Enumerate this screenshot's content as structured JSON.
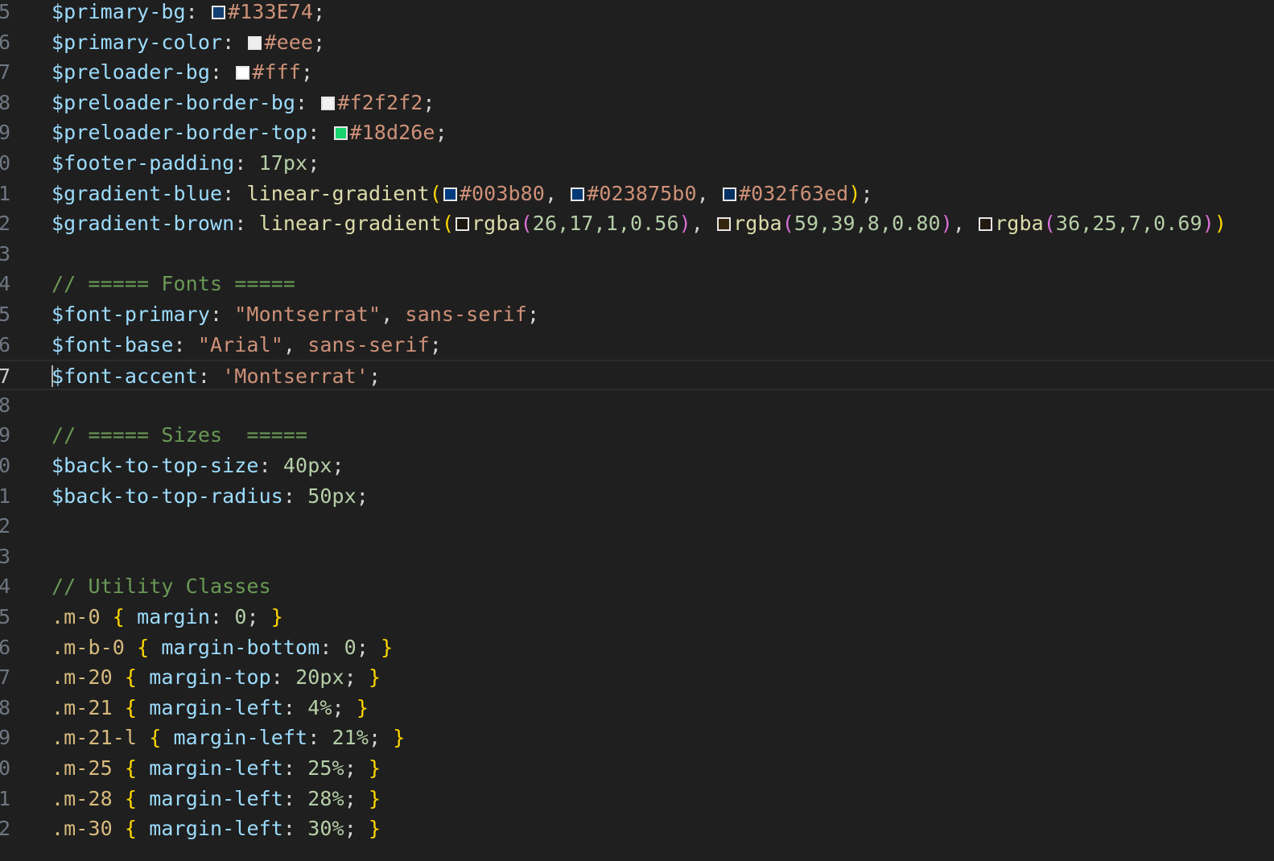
{
  "editor": {
    "active_line": 17,
    "lines": [
      {
        "no": "5",
        "tokens": [
          {
            "t": "$primary-bg",
            "c": "var"
          },
          {
            "t": ": ",
            "c": "txt"
          },
          {
            "swatch": "#133E74"
          },
          {
            "t": "#133E74",
            "c": "str"
          },
          {
            "t": ";",
            "c": "txt"
          }
        ]
      },
      {
        "no": "6",
        "tokens": [
          {
            "t": "$primary-color",
            "c": "var"
          },
          {
            "t": ": ",
            "c": "txt"
          },
          {
            "swatch": "#eeeeee"
          },
          {
            "t": "#eee",
            "c": "str"
          },
          {
            "t": ";",
            "c": "txt"
          }
        ]
      },
      {
        "no": "7",
        "tokens": [
          {
            "t": "$preloader-bg",
            "c": "var"
          },
          {
            "t": ": ",
            "c": "txt"
          },
          {
            "swatch": "#ffffff"
          },
          {
            "t": "#fff",
            "c": "str"
          },
          {
            "t": ";",
            "c": "txt"
          }
        ]
      },
      {
        "no": "8",
        "tokens": [
          {
            "t": "$preloader-border-bg",
            "c": "var"
          },
          {
            "t": ": ",
            "c": "txt"
          },
          {
            "swatch": "#f2f2f2"
          },
          {
            "t": "#f2f2f2",
            "c": "str"
          },
          {
            "t": ";",
            "c": "txt"
          }
        ]
      },
      {
        "no": "9",
        "tokens": [
          {
            "t": "$preloader-border-top",
            "c": "var"
          },
          {
            "t": ": ",
            "c": "txt"
          },
          {
            "swatch": "#18d26e"
          },
          {
            "t": "#18d26e",
            "c": "str"
          },
          {
            "t": ";",
            "c": "txt"
          }
        ]
      },
      {
        "no": "0",
        "tokens": [
          {
            "t": "$footer-padding",
            "c": "var"
          },
          {
            "t": ": ",
            "c": "txt"
          },
          {
            "t": "17px",
            "c": "num"
          },
          {
            "t": ";",
            "c": "txt"
          }
        ]
      },
      {
        "no": "1",
        "tokens": [
          {
            "t": "$gradient-blue",
            "c": "var"
          },
          {
            "t": ": ",
            "c": "txt"
          },
          {
            "t": "linear-gradient",
            "c": "fn"
          },
          {
            "t": "(",
            "c": "b1"
          },
          {
            "swatch": "#003b80"
          },
          {
            "t": "#003b80",
            "c": "str"
          },
          {
            "t": ", ",
            "c": "txt"
          },
          {
            "swatch": "#023875"
          },
          {
            "t": "#023875b0",
            "c": "str"
          },
          {
            "t": ", ",
            "c": "txt"
          },
          {
            "swatch": "#032f63"
          },
          {
            "t": "#032f63ed",
            "c": "str"
          },
          {
            "t": ")",
            "c": "b1"
          },
          {
            "t": ";",
            "c": "txt"
          }
        ]
      },
      {
        "no": "2",
        "tokens": [
          {
            "t": "$gradient-brown",
            "c": "var"
          },
          {
            "t": ": ",
            "c": "txt"
          },
          {
            "t": "linear-gradient",
            "c": "fn"
          },
          {
            "t": "(",
            "c": "b1"
          },
          {
            "swatch": "rgba(26,17,1,0.56)"
          },
          {
            "t": "rgba",
            "c": "fn"
          },
          {
            "t": "(",
            "c": "b2"
          },
          {
            "t": "26,17,1,0.56",
            "c": "num"
          },
          {
            "t": ")",
            "c": "b2"
          },
          {
            "t": ", ",
            "c": "txt"
          },
          {
            "swatch": "rgba(59,39,8,0.80)"
          },
          {
            "t": "rgba",
            "c": "fn"
          },
          {
            "t": "(",
            "c": "b2"
          },
          {
            "t": "59,39,8,0.80",
            "c": "num"
          },
          {
            "t": ")",
            "c": "b2"
          },
          {
            "t": ", ",
            "c": "txt"
          },
          {
            "swatch": "rgba(36,25,7,0.69)"
          },
          {
            "t": "rgba",
            "c": "fn"
          },
          {
            "t": "(",
            "c": "b2"
          },
          {
            "t": "36,25,7,0.69",
            "c": "num"
          },
          {
            "t": ")",
            "c": "b2"
          },
          {
            "t": ")",
            "c": "b1"
          }
        ]
      },
      {
        "no": "3",
        "tokens": []
      },
      {
        "no": "4",
        "tokens": [
          {
            "t": "// ===== Fonts =====",
            "c": "cmt"
          }
        ]
      },
      {
        "no": "5",
        "tokens": [
          {
            "t": "$font-primary",
            "c": "var"
          },
          {
            "t": ": ",
            "c": "txt"
          },
          {
            "t": "\"Montserrat\"",
            "c": "str"
          },
          {
            "t": ", ",
            "c": "txt"
          },
          {
            "t": "sans-serif",
            "c": "str"
          },
          {
            "t": ";",
            "c": "txt"
          }
        ]
      },
      {
        "no": "6",
        "tokens": [
          {
            "t": "$font-base",
            "c": "var"
          },
          {
            "t": ": ",
            "c": "txt"
          },
          {
            "t": "\"Arial\"",
            "c": "str"
          },
          {
            "t": ", ",
            "c": "txt"
          },
          {
            "t": "sans-serif",
            "c": "str"
          },
          {
            "t": ";",
            "c": "txt"
          }
        ]
      },
      {
        "no": "7",
        "tokens": [
          {
            "t": "$font-accent",
            "c": "var"
          },
          {
            "t": ": ",
            "c": "txt"
          },
          {
            "t": "'Montserrat'",
            "c": "str"
          },
          {
            "t": ";",
            "c": "txt"
          }
        ]
      },
      {
        "no": "8",
        "tokens": []
      },
      {
        "no": "9",
        "tokens": [
          {
            "t": "// ===== Sizes  =====",
            "c": "cmt"
          }
        ]
      },
      {
        "no": "0",
        "tokens": [
          {
            "t": "$back-to-top-size",
            "c": "var"
          },
          {
            "t": ": ",
            "c": "txt"
          },
          {
            "t": "40px",
            "c": "num"
          },
          {
            "t": ";",
            "c": "txt"
          }
        ]
      },
      {
        "no": "1",
        "tokens": [
          {
            "t": "$back-to-top-radius",
            "c": "var"
          },
          {
            "t": ": ",
            "c": "txt"
          },
          {
            "t": "50px",
            "c": "num"
          },
          {
            "t": ";",
            "c": "txt"
          }
        ]
      },
      {
        "no": "2",
        "tokens": []
      },
      {
        "no": "3",
        "tokens": []
      },
      {
        "no": "4",
        "tokens": [
          {
            "t": "// Utility Classes",
            "c": "cmt"
          }
        ]
      },
      {
        "no": "5",
        "tokens": [
          {
            "t": ".m-0",
            "c": "sel"
          },
          {
            "t": " ",
            "c": "txt"
          },
          {
            "t": "{",
            "c": "b1"
          },
          {
            "t": " ",
            "c": "txt"
          },
          {
            "t": "margin",
            "c": "var"
          },
          {
            "t": ": ",
            "c": "txt"
          },
          {
            "t": "0",
            "c": "num"
          },
          {
            "t": "; ",
            "c": "txt"
          },
          {
            "t": "}",
            "c": "b1"
          }
        ]
      },
      {
        "no": "6",
        "tokens": [
          {
            "t": ".m-b-0",
            "c": "sel"
          },
          {
            "t": " ",
            "c": "txt"
          },
          {
            "t": "{",
            "c": "b1"
          },
          {
            "t": " ",
            "c": "txt"
          },
          {
            "t": "margin-bottom",
            "c": "var"
          },
          {
            "t": ": ",
            "c": "txt"
          },
          {
            "t": "0",
            "c": "num"
          },
          {
            "t": "; ",
            "c": "txt"
          },
          {
            "t": "}",
            "c": "b1"
          }
        ]
      },
      {
        "no": "7",
        "tokens": [
          {
            "t": ".m-20",
            "c": "sel"
          },
          {
            "t": " ",
            "c": "txt"
          },
          {
            "t": "{",
            "c": "b1"
          },
          {
            "t": " ",
            "c": "txt"
          },
          {
            "t": "margin-top",
            "c": "var"
          },
          {
            "t": ": ",
            "c": "txt"
          },
          {
            "t": "20px",
            "c": "num"
          },
          {
            "t": "; ",
            "c": "txt"
          },
          {
            "t": "}",
            "c": "b1"
          }
        ]
      },
      {
        "no": "8",
        "tokens": [
          {
            "t": ".m-21",
            "c": "sel"
          },
          {
            "t": " ",
            "c": "txt"
          },
          {
            "t": "{",
            "c": "b1"
          },
          {
            "t": " ",
            "c": "txt"
          },
          {
            "t": "margin-left",
            "c": "var"
          },
          {
            "t": ": ",
            "c": "txt"
          },
          {
            "t": "4%",
            "c": "num"
          },
          {
            "t": "; ",
            "c": "txt"
          },
          {
            "t": "}",
            "c": "b1"
          }
        ]
      },
      {
        "no": "9",
        "tokens": [
          {
            "t": ".m-21-l",
            "c": "sel"
          },
          {
            "t": " ",
            "c": "txt"
          },
          {
            "t": "{",
            "c": "b1"
          },
          {
            "t": " ",
            "c": "txt"
          },
          {
            "t": "margin-left",
            "c": "var"
          },
          {
            "t": ": ",
            "c": "txt"
          },
          {
            "t": "21%",
            "c": "num"
          },
          {
            "t": "; ",
            "c": "txt"
          },
          {
            "t": "}",
            "c": "b1"
          }
        ]
      },
      {
        "no": "0",
        "tokens": [
          {
            "t": ".m-25",
            "c": "sel"
          },
          {
            "t": " ",
            "c": "txt"
          },
          {
            "t": "{",
            "c": "b1"
          },
          {
            "t": " ",
            "c": "txt"
          },
          {
            "t": "margin-left",
            "c": "var"
          },
          {
            "t": ": ",
            "c": "txt"
          },
          {
            "t": "25%",
            "c": "num"
          },
          {
            "t": "; ",
            "c": "txt"
          },
          {
            "t": "}",
            "c": "b1"
          }
        ]
      },
      {
        "no": "1",
        "tokens": [
          {
            "t": ".m-28",
            "c": "sel"
          },
          {
            "t": " ",
            "c": "txt"
          },
          {
            "t": "{",
            "c": "b1"
          },
          {
            "t": " ",
            "c": "txt"
          },
          {
            "t": "margin-left",
            "c": "var"
          },
          {
            "t": ": ",
            "c": "txt"
          },
          {
            "t": "28%",
            "c": "num"
          },
          {
            "t": "; ",
            "c": "txt"
          },
          {
            "t": "}",
            "c": "b1"
          }
        ]
      },
      {
        "no": "2",
        "tokens": [
          {
            "t": ".m-30",
            "c": "sel"
          },
          {
            "t": " ",
            "c": "txt"
          },
          {
            "t": "{",
            "c": "b1"
          },
          {
            "t": " ",
            "c": "txt"
          },
          {
            "t": "margin-left",
            "c": "var"
          },
          {
            "t": ": ",
            "c": "txt"
          },
          {
            "t": "30%",
            "c": "num"
          },
          {
            "t": "; ",
            "c": "txt"
          },
          {
            "t": "}",
            "c": "b1"
          }
        ]
      }
    ]
  }
}
